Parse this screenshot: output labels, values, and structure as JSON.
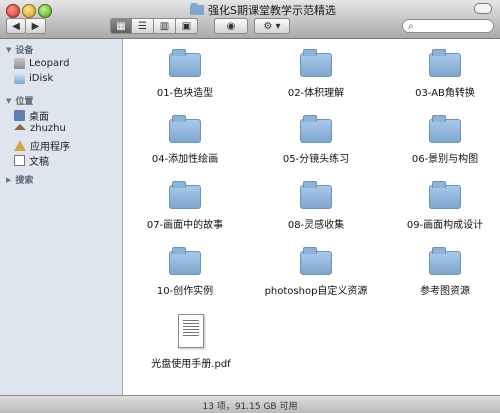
{
  "window": {
    "title": "强化S期课堂教学示范精选"
  },
  "toolbar": {
    "back_label": "◀",
    "forward_label": "▶",
    "view_icons": "▦",
    "view_list": "☰",
    "view_columns": "▥",
    "view_coverflow": "▣",
    "quicklook_label": "◉",
    "action_label": "⚙ ▾",
    "search_glyph": "⌕",
    "search_placeholder": ""
  },
  "sidebar": {
    "devices_header": "设备",
    "devices": [
      "Leopard",
      "iDisk"
    ],
    "places_header": "位置",
    "places": [
      "桌面",
      "zhuzhu",
      "应用程序",
      "文稿"
    ],
    "search_header": "搜索"
  },
  "files": [
    "01-色块造型",
    "02-体积理解",
    "03-AB角转换",
    "04-添加性绘画",
    "05-分镜头练习",
    "06-景别与构图",
    "07-画面中的故事",
    "08-灵感收集",
    "09-画面构成设计",
    "10-创作实例",
    "photoshop自定义资源",
    "参考图资源",
    "光盘使用手册.pdf"
  ],
  "status": {
    "text": "13 项，91.15 GB 可用"
  },
  "colors": {
    "folder": "#7fa6cf",
    "sidebar": "#dfe5ee",
    "accent": "#5f6f85"
  }
}
